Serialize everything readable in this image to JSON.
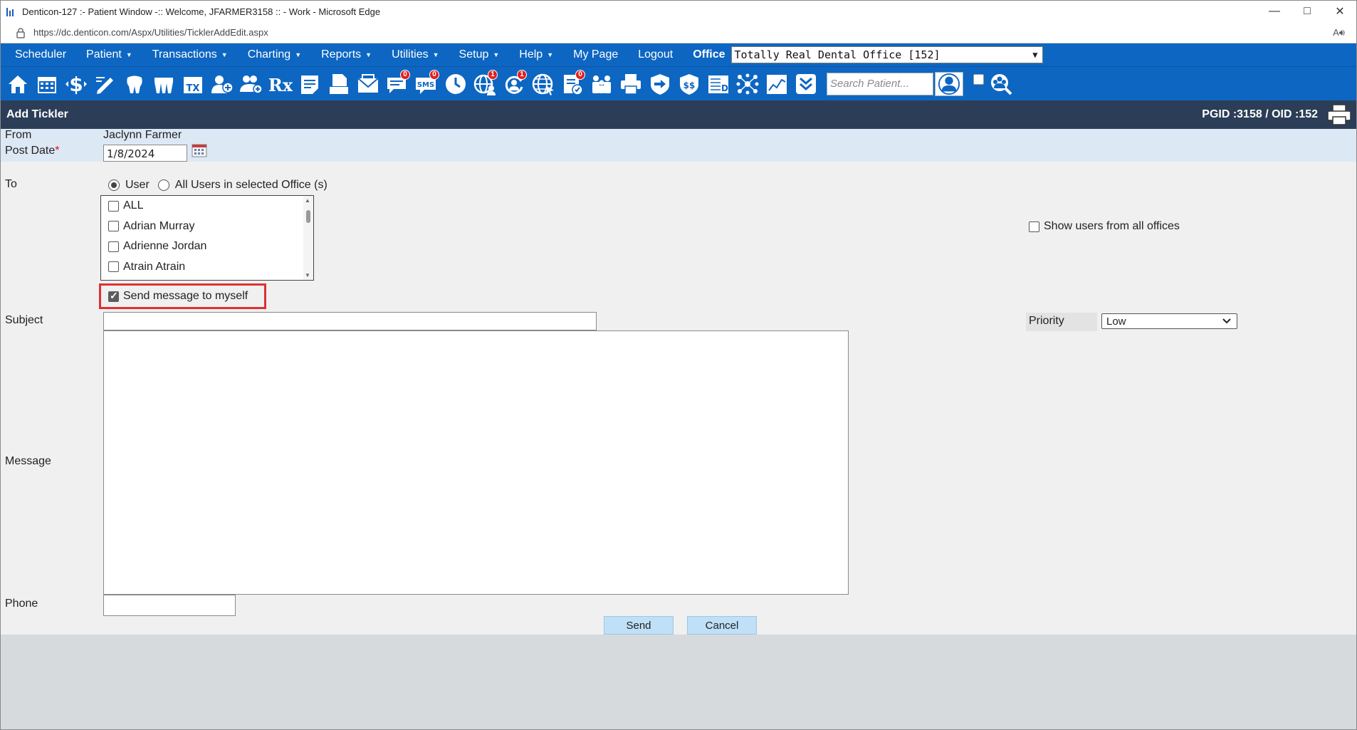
{
  "window": {
    "title": "Denticon-127 :- Patient Window -:: Welcome, JFARMER3158 :: - Work - Microsoft Edge",
    "url": "https://dc.denticon.com/Aspx/Utilities/TicklerAddEdit.aspx"
  },
  "menu": {
    "items": [
      {
        "label": "Scheduler",
        "caret": false
      },
      {
        "label": "Patient",
        "caret": true
      },
      {
        "label": "Transactions",
        "caret": true
      },
      {
        "label": "Charting",
        "caret": true
      },
      {
        "label": "Reports",
        "caret": true
      },
      {
        "label": "Utilities",
        "caret": true
      },
      {
        "label": "Setup",
        "caret": true
      },
      {
        "label": "Help",
        "caret": true
      },
      {
        "label": "My Page",
        "caret": false
      },
      {
        "label": "Logout",
        "caret": false
      }
    ],
    "office_label": "Office",
    "office_value": "Totally Real Dental Office [152]"
  },
  "toolbar": {
    "icons": [
      "home-icon",
      "calendar-icon",
      "dollar-icon",
      "pencil-icon",
      "tooth-icon",
      "teeth-icon",
      "tx-icon",
      "add-patient-icon",
      "add-family-icon",
      "rx-icon",
      "notes-icon",
      "document-icon",
      "mail-icon",
      "chat-icon",
      "sms-icon",
      "clock-icon",
      "globe-users-icon",
      "sync-icon",
      "web-icon",
      "doc-check-icon",
      "family-icon",
      "printer-icon",
      "arrow-right-icon",
      "insurance-icon",
      "ledger-icon",
      "network-icon",
      "chart-icon",
      "download-icon"
    ],
    "badges": {
      "chat": "0",
      "sms": "0",
      "globe_users": "1",
      "sync": "1",
      "doc_check": "0"
    },
    "search_placeholder": "Search Patient..."
  },
  "header": {
    "title": "Add Tickler",
    "ids": "PGID :3158  /  OID :152"
  },
  "form": {
    "from_label": "From",
    "from_value": "Jaclynn Farmer",
    "post_date_label": "Post Date",
    "required_mark": "*",
    "post_date_value": "1/8/2024",
    "to_label": "To",
    "radio_user": "User",
    "radio_all": "All Users in selected Office (s)",
    "users": [
      "ALL",
      "Adrian Murray",
      "Adrienne Jordan",
      "Atrain Atrain"
    ],
    "show_all_offices": "Show users from all offices",
    "send_to_self": "Send message to myself",
    "subject_label": "Subject",
    "subject_value": "",
    "priority_label": "Priority",
    "priority_value": "Low",
    "message_label": "Message",
    "message_value": "",
    "phone_label": "Phone",
    "phone_value": "",
    "send_button": "Send",
    "cancel_button": "Cancel"
  },
  "colors": {
    "menu_bg": "#0d66c2",
    "header_bg": "#2c3e57",
    "highlight": "#e03030",
    "button_bg": "#bfe0f7"
  }
}
